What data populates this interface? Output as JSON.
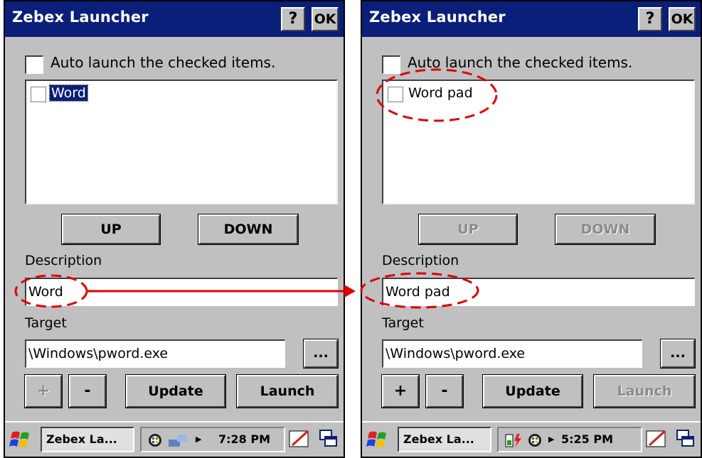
{
  "screens": [
    {
      "title": "Zebex Launcher",
      "help_label": "?",
      "ok_label": "OK",
      "auto_launch_label": "Auto launch the checked items.",
      "list_item_label": "Word",
      "up_label": "UP",
      "down_label": "DOWN",
      "description_label": "Description",
      "description_value": "Word",
      "target_label": "Target",
      "target_value": "\\Windows\\pword.exe",
      "browse_label": "...",
      "plus_label": "+",
      "minus_label": "-",
      "update_label": "Update",
      "launch_label": "Launch",
      "taskbar_item": "Zebex La...",
      "clock": "7:28 PM",
      "disabled": [
        "plus"
      ]
    },
    {
      "title": "Zebex Launcher",
      "help_label": "?",
      "ok_label": "OK",
      "auto_launch_label": "Auto launch the checked items.",
      "list_item_label": "Word pad",
      "up_label": "UP",
      "down_label": "DOWN",
      "description_label": "Description",
      "description_value": "Word pad",
      "target_label": "Target",
      "target_value": "\\Windows\\pword.exe",
      "browse_label": "...",
      "plus_label": "+",
      "minus_label": "-",
      "update_label": "Update",
      "launch_label": "Launch",
      "taskbar_item": "Zebex La...",
      "clock": "5:25 PM",
      "disabled": [
        "up",
        "down",
        "launch"
      ]
    }
  ],
  "colors": {
    "titlebar": "#0a1f7a",
    "window_bg": "#c0c0c0",
    "annotation": "#e00000"
  },
  "icons": {
    "title_buttons": [
      "help-icon",
      "ok-button"
    ],
    "taskbar": [
      "windows-start-icon",
      "network-icon",
      "battery-charging-icon",
      "pen-input-icon",
      "desktop-switch-icon"
    ]
  }
}
